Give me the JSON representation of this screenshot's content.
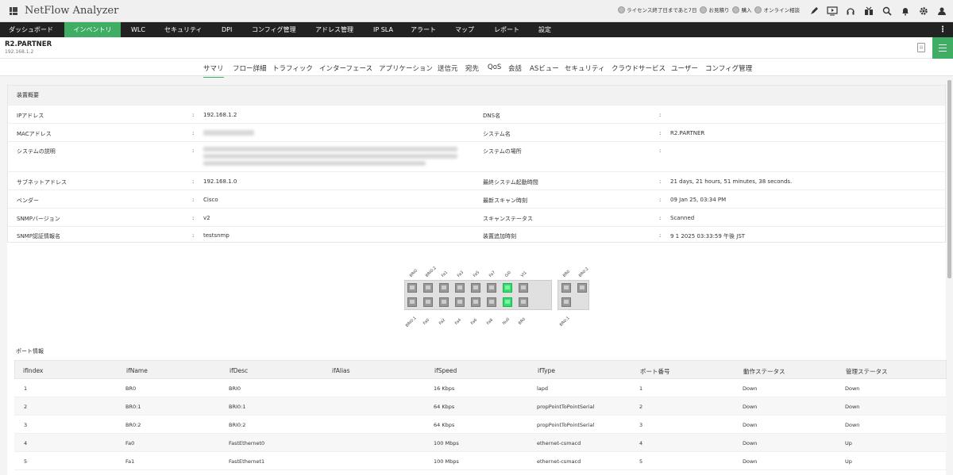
{
  "app": {
    "title": "NetFlow Analyzer"
  },
  "top_links": [
    {
      "icon": "license-icon",
      "label": "ライセンス終了日まであと7日"
    },
    {
      "icon": "quote-icon",
      "label": "お見積り"
    },
    {
      "icon": "purchase-icon",
      "label": "購入"
    },
    {
      "icon": "consult-icon",
      "label": "オンライン相談"
    }
  ],
  "top_icons": [
    "rocket-icon",
    "video-icon",
    "headset-icon",
    "gift-icon",
    "search-icon",
    "bell-icon",
    "gear-icon",
    "user-icon"
  ],
  "main_nav": [
    {
      "label": "ダッシュボード",
      "active": false
    },
    {
      "label": "インベントリ",
      "active": true
    },
    {
      "label": "WLC",
      "active": false
    },
    {
      "label": "セキュリティ",
      "active": false
    },
    {
      "label": "DPI",
      "active": false
    },
    {
      "label": "コンフィグ管理",
      "active": false
    },
    {
      "label": "アドレス管理",
      "active": false
    },
    {
      "label": "IP SLA",
      "active": false
    },
    {
      "label": "アラート",
      "active": false
    },
    {
      "label": "マップ",
      "active": false
    },
    {
      "label": "レポート",
      "active": false
    },
    {
      "label": "設定",
      "active": false
    }
  ],
  "device": {
    "name": "R2.PARTNER",
    "ip": "192.168.1.2"
  },
  "sub_tabs": [
    {
      "label": "サマリ",
      "active": true
    },
    {
      "label": "フロー詳細"
    },
    {
      "label": "トラフィック"
    },
    {
      "label": "インターフェース"
    },
    {
      "label": "アプリケーション"
    },
    {
      "label": "送信元"
    },
    {
      "label": "宛先"
    },
    {
      "label": "QoS"
    },
    {
      "label": "会話"
    },
    {
      "label": "ASビュー"
    },
    {
      "label": "セキュリティ"
    },
    {
      "label": "クラウドサービス"
    },
    {
      "label": "ユーザー"
    },
    {
      "label": "コンフィグ管理"
    }
  ],
  "summary": {
    "title": "装置概要",
    "separator": ":",
    "rows": [
      {
        "l_label": "IPアドレス",
        "l_value": "192.168.1.2",
        "r_label": "DNS名",
        "r_value": ""
      },
      {
        "l_label": "MACアドレス",
        "l_value": "",
        "r_label": "システム名",
        "r_value": "R2.PARTNER"
      },
      {
        "l_label": "システムの説明",
        "l_value": "",
        "r_label": "システムの場所",
        "r_value": ""
      },
      {
        "l_label": "サブネットアドレス",
        "l_value": "192.168.1.0",
        "r_label": "最終システム起動時間",
        "r_value": "21 days, 21 hours, 51 minutes, 38 seconds."
      },
      {
        "l_label": "ベンダー",
        "l_value": "Cisco",
        "r_label": "最新スキャン時刻",
        "r_value": "09 Jan 25, 03:34 PM"
      },
      {
        "l_label": "SNMPバージョン",
        "l_value": "v2",
        "r_label": "スキャンステータス",
        "r_value": "Scanned"
      },
      {
        "l_label": "SNMP認証情報名",
        "l_value": "testsnmp",
        "r_label": "装置追加時刻",
        "r_value": "9 1 2025 03:33:59 午後 JST"
      }
    ]
  },
  "ports_diagram": {
    "top_labels": [
      "BRI0",
      "BRI0:2",
      "Fa1",
      "Fa3",
      "Fa5",
      "Fa7",
      "Gi0",
      "Vl1"
    ],
    "bottom_labels": [
      "BRI0:1",
      "Fa0",
      "Fa2",
      "Fa4",
      "Fa6",
      "Fa8",
      "Nu0",
      "BR0"
    ],
    "top_active": [
      false,
      false,
      false,
      false,
      false,
      false,
      true,
      false
    ],
    "bottom_active": [
      false,
      false,
      false,
      false,
      false,
      false,
      true,
      false
    ],
    "side_top_labels": [
      "BR0",
      "BR0:2"
    ],
    "side_bottom_labels": [
      "BR0:1"
    ]
  },
  "port_info": {
    "title": "ポート情報",
    "columns": [
      "ifIndex",
      "ifName",
      "ifDesc",
      "ifAlias",
      "ifSpeed",
      "ifType",
      "ポート番号",
      "動作ステータス",
      "管理ステータス"
    ],
    "rows": [
      [
        "1",
        "BR0",
        "BRI0",
        "",
        "16 Kbps",
        "lapd",
        "1",
        "Down",
        "Down"
      ],
      [
        "2",
        "BR0:1",
        "BRI0:1",
        "",
        "64 Kbps",
        "propPointToPointSerial",
        "2",
        "Down",
        "Down"
      ],
      [
        "3",
        "BR0:2",
        "BRI0:2",
        "",
        "64 Kbps",
        "propPointToPointSerial",
        "3",
        "Down",
        "Down"
      ],
      [
        "4",
        "Fa0",
        "FastEthernet0",
        "",
        "100 Mbps",
        "ethernet-csmacd",
        "4",
        "Down",
        "Up"
      ],
      [
        "5",
        "Fa1",
        "FastEthernet1",
        "",
        "100 Mbps",
        "ethernet-csmacd",
        "5",
        "Down",
        "Up"
      ]
    ]
  },
  "colors": {
    "accent": "#3fae64",
    "nav_bg": "#222222",
    "port_active": "#2ee06c"
  }
}
